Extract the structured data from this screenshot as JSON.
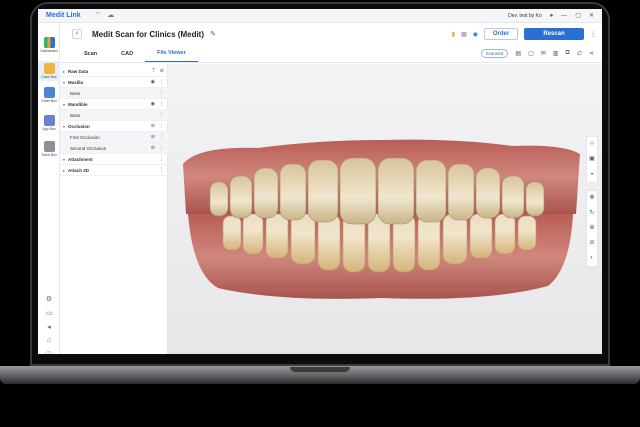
{
  "titlebar": {
    "brand": "Medit Link",
    "user": "Dev. test by Ko"
  },
  "rail": [
    {
      "label": "Dashboard",
      "icon": "chart-icon"
    },
    {
      "label": "Case Box",
      "icon": "folder-icon"
    },
    {
      "label": "Order Box",
      "icon": "order-icon"
    },
    {
      "label": "App Box",
      "icon": "app-icon"
    },
    {
      "label": "Trash Box",
      "icon": "trash-icon"
    }
  ],
  "header": {
    "title": "Medit Scan for Clinics (Medit)",
    "order": "Order",
    "rescan": "Rescan"
  },
  "tabs": [
    {
      "label": "Scan",
      "active": false
    },
    {
      "label": "CAD",
      "active": false
    },
    {
      "label": "File Viewer",
      "active": true
    }
  ],
  "toolbar": {
    "scanned": "Scanned"
  },
  "panel": [
    {
      "label": "Raw Data",
      "level": 0
    },
    {
      "label": "Maxilla",
      "level": 0
    },
    {
      "label": "Base",
      "level": 1
    },
    {
      "label": "Mandible",
      "level": 0
    },
    {
      "label": "Base",
      "level": 1
    },
    {
      "label": "Occlusion",
      "level": 0
    },
    {
      "label": "First Occlusion",
      "level": 1
    },
    {
      "label": "Second Occlusion",
      "level": 1
    },
    {
      "label": "Attachment",
      "level": 0
    },
    {
      "label": "Attach 3D",
      "level": 0
    }
  ],
  "colors": {
    "accent": "#2a6fd1",
    "gum": "#c4776e",
    "tooth": "#e9dcc2"
  }
}
